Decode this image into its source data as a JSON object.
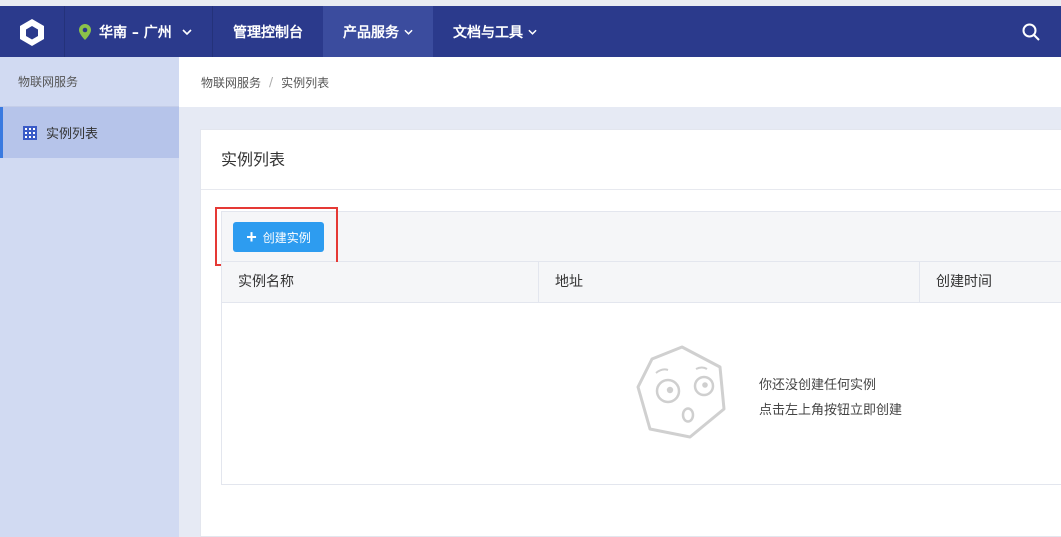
{
  "topbar": {
    "region": "华南 – 广州",
    "nav": [
      {
        "label": "管理控制台"
      },
      {
        "label": "产品服务"
      },
      {
        "label": "文档与工具"
      }
    ]
  },
  "sidebar": {
    "title": "物联网服务",
    "items": [
      {
        "label": "实例列表"
      }
    ]
  },
  "breadcrumb": {
    "root": "物联网服务",
    "separator": "/",
    "current": "实例列表"
  },
  "main": {
    "title": "实例列表",
    "create_button": "创建实例",
    "columns": [
      "实例名称",
      "地址",
      "创建时间"
    ],
    "empty": {
      "line1": "你还没创建任何实例",
      "line2": "点击左上角按钮立即创建"
    }
  },
  "colors": {
    "topbar": "#2b3a8c",
    "sidebar": "#d1daf2",
    "accent_button": "#2d9cf0",
    "highlight_box": "#e53935",
    "location_pin": "#8bc34a"
  }
}
